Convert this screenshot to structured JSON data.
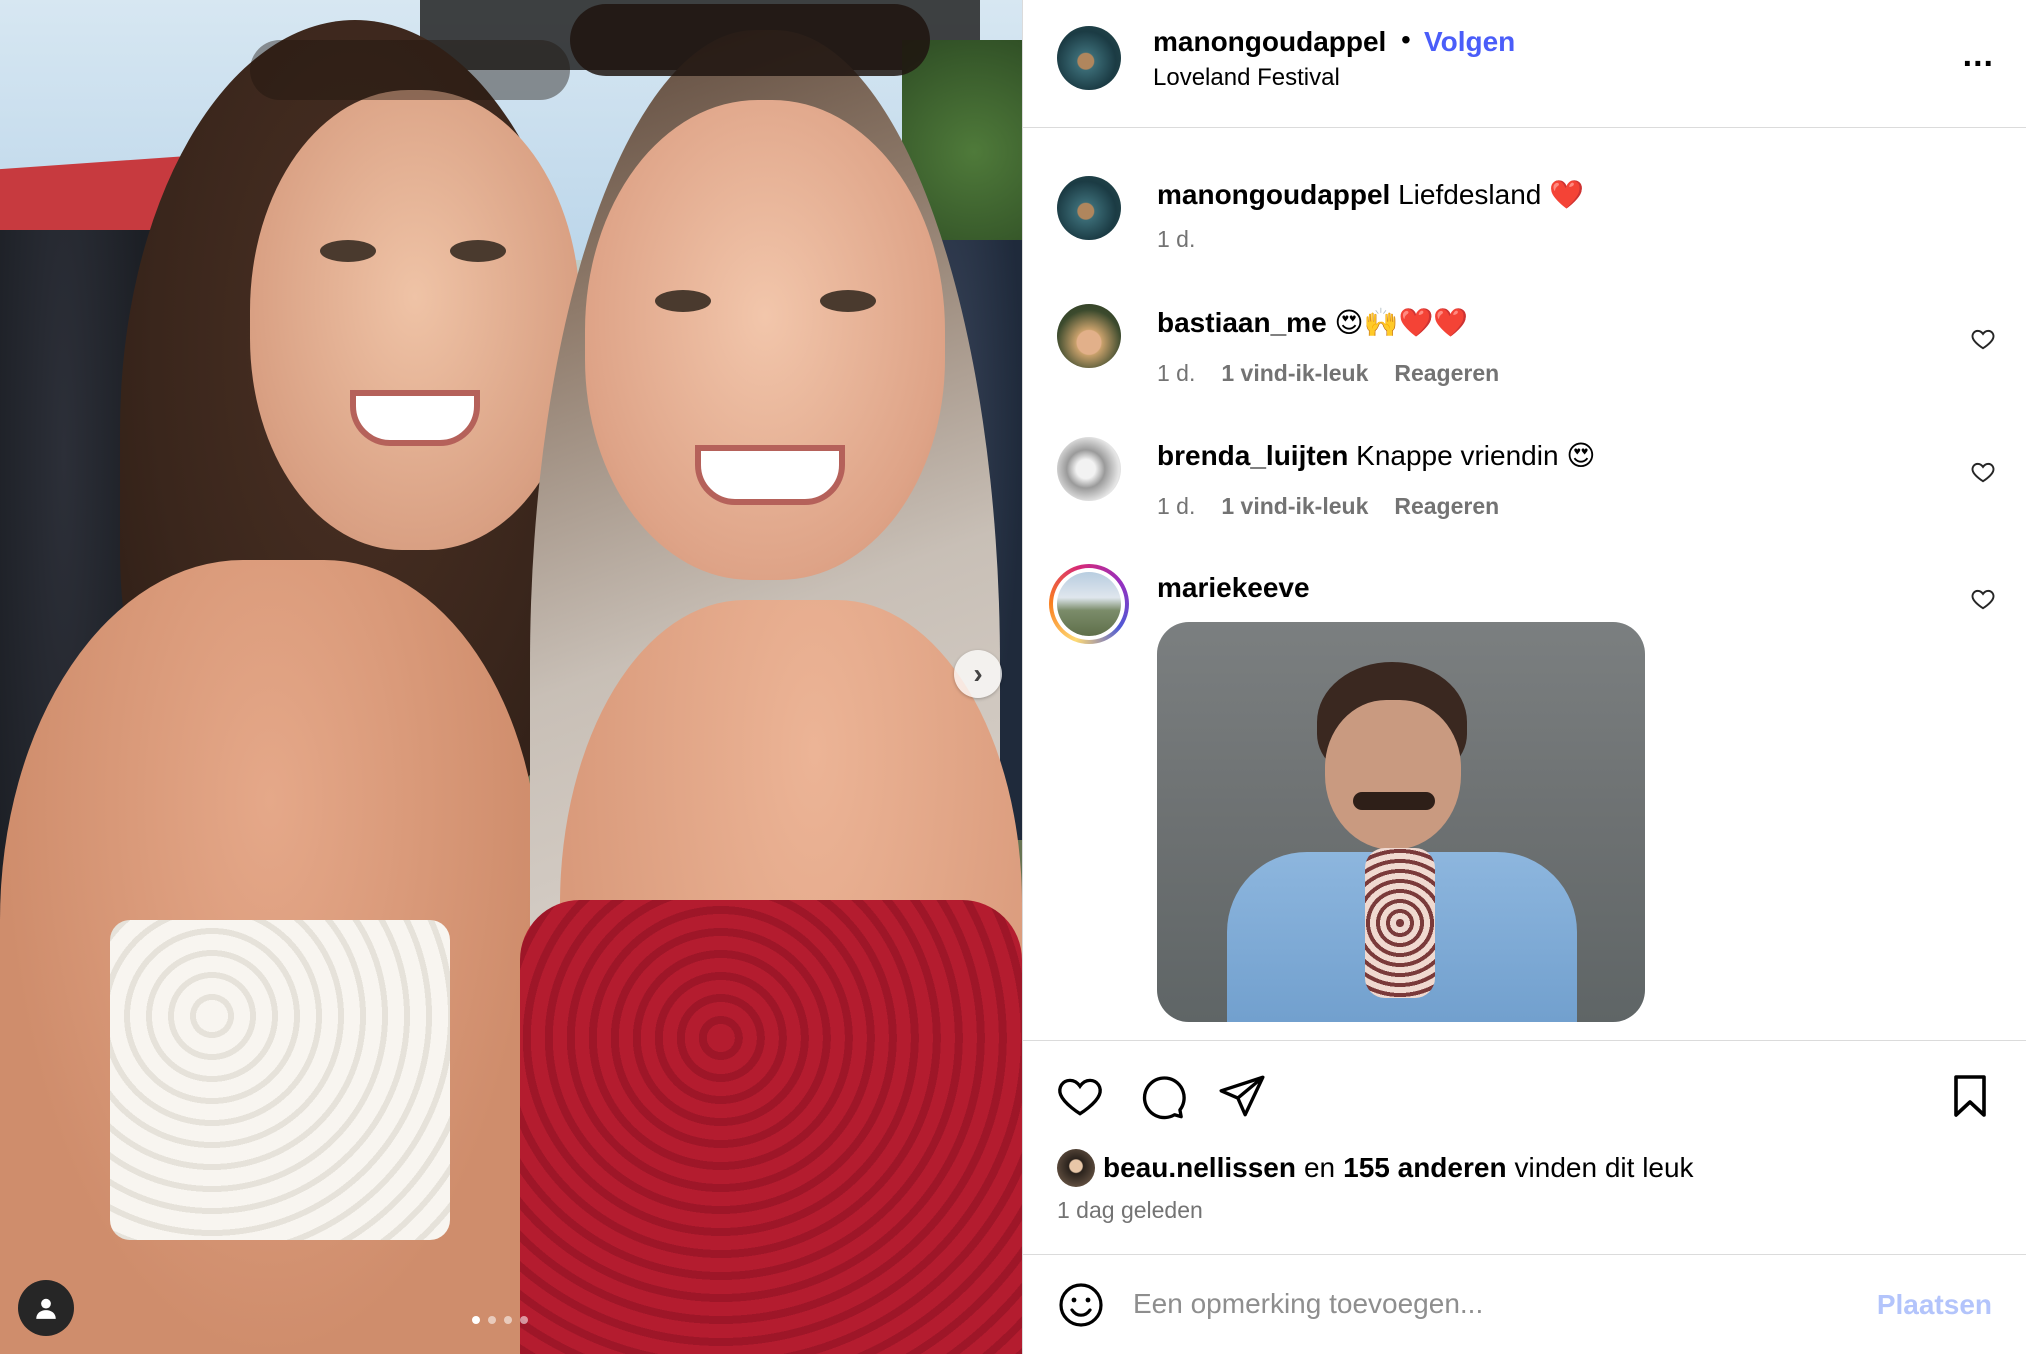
{
  "header": {
    "username": "manongoudappel",
    "separator": "•",
    "follow_label": "Volgen",
    "location": "Loveland Festival",
    "more_label": "..."
  },
  "caption": {
    "username": "manongoudappel",
    "text": "Liefdesland ❤️",
    "time": "1 d."
  },
  "comments": [
    {
      "username": "bastiaan_me",
      "text": "😍🙌❤️❤️",
      "time": "1 d.",
      "likes": "1 vind-ik-leuk",
      "reply_label": "Reageren"
    },
    {
      "username": "brenda_luijten",
      "text": "Knappe vriendin 😍",
      "time": "1 d.",
      "likes": "1 vind-ik-leuk",
      "reply_label": "Reageren"
    },
    {
      "username": "mariekeeve",
      "text": ""
    }
  ],
  "likes": {
    "first_user": "beau.nellissen",
    "connector": "en",
    "others": "155 anderen",
    "suffix": "vinden dit leuk"
  },
  "post_time": "1 dag geleden",
  "comment_bar": {
    "placeholder": "Een opmerking toevoegen...",
    "post_label": "Plaatsen"
  },
  "carousel": {
    "next_label": "›",
    "total": 4,
    "active": 1
  },
  "icons": {
    "header_avatar": "lake-photo-avatar",
    "like": "heart-icon",
    "comment": "comment-bubble-icon",
    "share": "paper-plane-icon",
    "save": "bookmark-icon",
    "emoji": "smiley-icon",
    "tag": "person-icon"
  },
  "colors": {
    "follow_blue": "#4a5df9",
    "post_button_disabled": "#b3c4fb",
    "meta_gray": "#737373",
    "border": "#dbdbdb"
  }
}
